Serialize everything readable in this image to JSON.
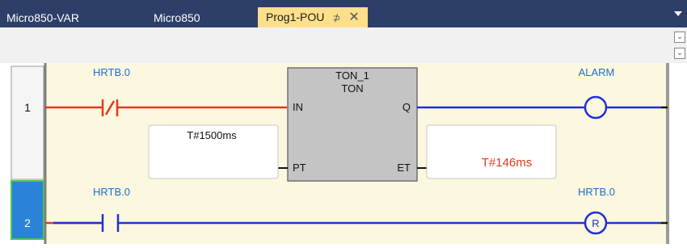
{
  "tabs": [
    {
      "label": "Micro850-VAR"
    },
    {
      "label": "Micro850"
    },
    {
      "label": "Prog1-POU",
      "active": true
    }
  ],
  "tab_pin_glyph": "⊅",
  "tab_close_glyph": "✕",
  "expand_glyph": "⌄",
  "rungs": [
    {
      "number": "1",
      "contact_label": "HRTB.0",
      "coil_label": "ALARM"
    },
    {
      "number": "2",
      "contact_label": "HRTB.0",
      "coil_label": "HRTB.0",
      "coil_letter": "R"
    }
  ],
  "timer": {
    "instance": "TON_1",
    "type": "TON",
    "pin_in": "IN",
    "pin_q": "Q",
    "pin_pt": "PT",
    "pin_et": "ET",
    "pt_value": "T#1500ms",
    "et_value": "T#146ms"
  },
  "colors": {
    "tab_bar": "#2d3f68",
    "active_tab": "#ffe08a",
    "rung_background": "#fcf8e0",
    "energized": "#e03a1e",
    "deenergized": "#2030d8",
    "block_fill": "#c4c4c4",
    "selected_rung": "#2a83d8"
  }
}
